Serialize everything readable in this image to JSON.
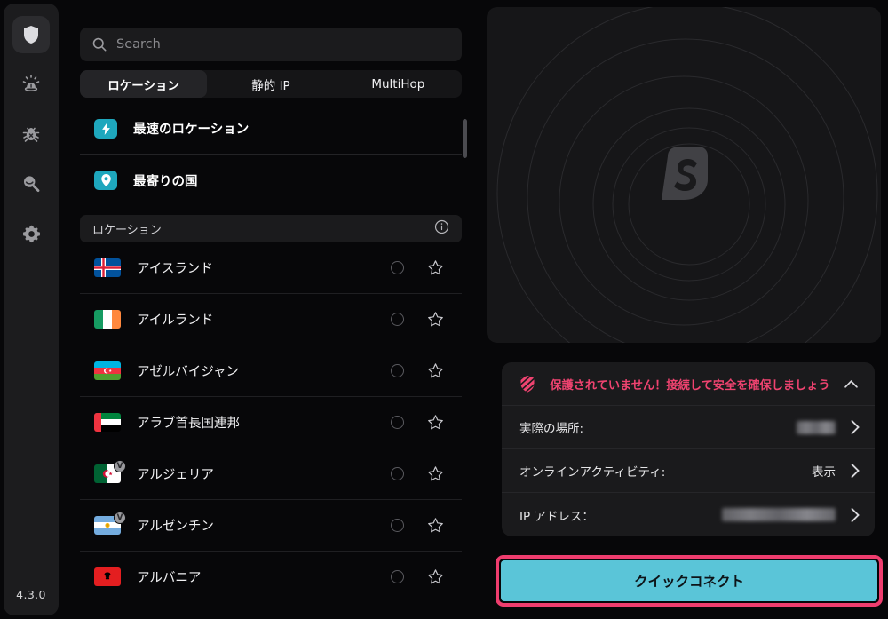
{
  "app": {
    "version": "4.3.0",
    "accent_cyan": "#1ea7bd",
    "accent_button": "#5ac5d8",
    "highlight_pink": "#ef3d6e",
    "alert_red": "#ef4370",
    "background": "#070709"
  },
  "sidebar": {
    "items": [
      {
        "name": "vpn",
        "icon": "shield-icon",
        "active": true
      },
      {
        "name": "alert",
        "icon": "alert-light-icon",
        "active": false
      },
      {
        "name": "antivirus",
        "icon": "bug-icon",
        "active": false
      },
      {
        "name": "search-alternative-id",
        "icon": "magnifier-icon",
        "active": false
      },
      {
        "name": "settings",
        "icon": "gear-icon",
        "active": false
      }
    ],
    "version_label": "4.3.0"
  },
  "search": {
    "placeholder": "Search",
    "value": "",
    "icon": "search-icon"
  },
  "tabs": [
    {
      "label": "ロケーション",
      "active": true
    },
    {
      "label": "静的 IP",
      "active": false
    },
    {
      "label": "MultiHop",
      "active": false
    }
  ],
  "quick_rows": [
    {
      "label": "最速のロケーション",
      "icon": "lightning-icon"
    },
    {
      "label": "最寄りの国",
      "icon": "location-pin-icon"
    }
  ],
  "section_header": {
    "label": "ロケーション",
    "info_icon": "info-icon"
  },
  "countries": [
    {
      "name": "アイスランド",
      "flag": "iceland",
      "virtual": false
    },
    {
      "name": "アイルランド",
      "flag": "ireland",
      "virtual": false
    },
    {
      "name": "アゼルバイジャン",
      "flag": "azerbaijan",
      "virtual": false
    },
    {
      "name": "アラブ首長国連邦",
      "flag": "uae",
      "virtual": false
    },
    {
      "name": "アルジェリア",
      "flag": "algeria",
      "virtual": true,
      "virtual_badge": "V"
    },
    {
      "name": "アルゼンチン",
      "flag": "argentina",
      "virtual": true,
      "virtual_badge": "V"
    },
    {
      "name": "アルバニア",
      "flag": "albania",
      "virtual": false
    }
  ],
  "map": {
    "logo_icon": "surfshark-logo-icon"
  },
  "status_card": {
    "header": {
      "message": "保護されていません！接続して安全を確保しましょう",
      "shield_icon": "shield-unprotected-icon",
      "collapse_icon": "chevron-up-icon"
    },
    "rows": [
      {
        "label": "実際の場所:",
        "value": "",
        "redacted": true,
        "redact_width": 44,
        "chevron": "chevron-right-icon"
      },
      {
        "label": "オンラインアクティビティ:",
        "value": "表示",
        "redacted": false,
        "chevron": "chevron-right-icon"
      },
      {
        "label": "IP アドレス：",
        "value": "",
        "redacted": true,
        "redact_width": 128,
        "chevron": "chevron-right-icon"
      }
    ]
  },
  "quick_connect": {
    "label": "クイックコネクト"
  }
}
